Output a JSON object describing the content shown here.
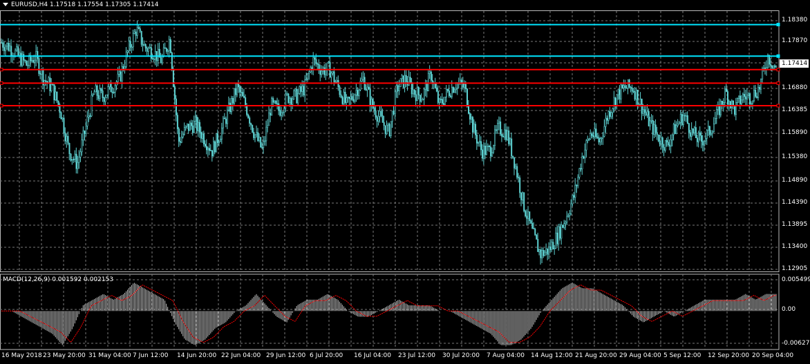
{
  "window": {
    "header": "EURUSD,H4  1.17518 1.17554 1.17305 1.17414",
    "current_price": "1.17414"
  },
  "macd_panel": {
    "header": "MACD(12,26,9) 0.001592 0.002153",
    "axis_labels": [
      "0.005499",
      "0.00",
      "-0.006272"
    ]
  },
  "price_axis": {
    "labels": [
      "1.18380",
      "1.17870",
      "1.17414",
      "1.16880",
      "1.16385",
      "1.15890",
      "1.15380",
      "1.14890",
      "1.14390",
      "1.13895",
      "1.13400",
      "1.12905"
    ]
  },
  "time_axis": {
    "labels": [
      "16 May 2018",
      "23 May 20:00",
      "31 May 04:00",
      "7 Jun 12:00",
      "14 Jun 20:00",
      "22 Jun 04:00",
      "29 Jun 12:00",
      "6 Jul 20:00",
      "16 Jul 04:00",
      "23 Jul 12:00",
      "30 Jul 20:00",
      "7 Aug 04:00",
      "14 Aug 12:00",
      "21 Aug 20:00",
      "29 Aug 04:00",
      "5 Sep 12:00",
      "12 Sep 20:00",
      "20 Sep 04:00"
    ]
  },
  "colors": {
    "background": "#000000",
    "grid": "#7a7a7a",
    "candles": "#5fd3d3",
    "resistance_lines": "#00e5ff",
    "support_lines": "#ff0000",
    "macd_histogram": "#c0c0c0",
    "macd_signal": "#ff0000"
  },
  "chart_data": {
    "type": "candlestick",
    "symbol": "EURUSD",
    "timeframe": "H4",
    "ohlc_last": {
      "open": 1.17518,
      "high": 1.17554,
      "low": 1.17305,
      "close": 1.17414
    },
    "ylim": [
      1.12905,
      1.187
    ],
    "x_range": [
      "16 May 2018",
      "20 Sep 04:00"
    ],
    "horizontal_levels": [
      {
        "price": 1.184,
        "color": "cyan"
      },
      {
        "price": 1.177,
        "color": "cyan"
      },
      {
        "price": 1.174,
        "color": "red"
      },
      {
        "price": 1.171,
        "color": "red"
      },
      {
        "price": 1.166,
        "color": "red"
      }
    ],
    "close_path": [
      [
        "16 May 2018",
        1.18
      ],
      [
        "17 May",
        1.179
      ],
      [
        "18 May",
        1.177
      ],
      [
        "21 May",
        1.175
      ],
      [
        "22 May",
        1.177
      ],
      [
        "23 May",
        1.172
      ],
      [
        "24 May",
        1.17
      ],
      [
        "25 May",
        1.165
      ],
      [
        "28 May",
        1.156
      ],
      [
        "29 May",
        1.153
      ],
      [
        "30 May",
        1.161
      ],
      [
        "31 May",
        1.169
      ],
      [
        "1 Jun",
        1.168
      ],
      [
        "4 Jun",
        1.17
      ],
      [
        "5 Jun",
        1.172
      ],
      [
        "6 Jun",
        1.178
      ],
      [
        "7 Jun",
        1.183
      ],
      [
        "8 Jun",
        1.179
      ],
      [
        "11 Jun",
        1.178
      ],
      [
        "12 Jun",
        1.176
      ],
      [
        "13 Jun",
        1.181
      ],
      [
        "14 Jun",
        1.158
      ],
      [
        "15 Jun",
        1.161
      ],
      [
        "18 Jun",
        1.162
      ],
      [
        "19 Jun",
        1.159
      ],
      [
        "20 Jun",
        1.156
      ],
      [
        "21 Jun",
        1.16
      ],
      [
        "22 Jun",
        1.165
      ],
      [
        "25 Jun",
        1.17
      ],
      [
        "26 Jun",
        1.166
      ],
      [
        "27 Jun",
        1.16
      ],
      [
        "28 Jun",
        1.156
      ],
      [
        "29 Jun",
        1.166
      ],
      [
        "2 Jul",
        1.165
      ],
      [
        "3 Jul",
        1.168
      ],
      [
        "4 Jul",
        1.168
      ],
      [
        "5 Jul",
        1.17
      ],
      [
        "6 Jul",
        1.176
      ],
      [
        "9 Jul",
        1.174
      ],
      [
        "10 Jul",
        1.174
      ],
      [
        "11 Jul",
        1.17
      ],
      [
        "12 Jul",
        1.166
      ],
      [
        "13 Jul",
        1.169
      ],
      [
        "16 Jul",
        1.172
      ],
      [
        "17 Jul",
        1.166
      ],
      [
        "18 Jul",
        1.163
      ],
      [
        "19 Jul",
        1.16
      ],
      [
        "20 Jul",
        1.17
      ],
      [
        "23 Jul",
        1.172
      ],
      [
        "24 Jul",
        1.169
      ],
      [
        "25 Jul",
        1.168
      ],
      [
        "26 Jul",
        1.173
      ],
      [
        "27 Jul",
        1.166
      ],
      [
        "30 Jul",
        1.169
      ],
      [
        "31 Jul",
        1.171
      ],
      [
        "1 Aug",
        1.17
      ],
      [
        "2 Aug",
        1.161
      ],
      [
        "3 Aug",
        1.156
      ],
      [
        "6 Aug",
        1.156
      ],
      [
        "7 Aug",
        1.161
      ],
      [
        "8 Aug",
        1.16
      ],
      [
        "9 Aug",
        1.153
      ],
      [
        "10 Aug",
        1.144
      ],
      [
        "13 Aug",
        1.138
      ],
      [
        "14 Aug",
        1.133
      ],
      [
        "15 Aug",
        1.134
      ],
      [
        "16 Aug",
        1.137
      ],
      [
        "17 Aug",
        1.141
      ],
      [
        "20 Aug",
        1.146
      ],
      [
        "21 Aug",
        1.155
      ],
      [
        "22 Aug",
        1.16
      ],
      [
        "23 Aug",
        1.158
      ],
      [
        "24 Aug",
        1.164
      ],
      [
        "27 Aug",
        1.168
      ],
      [
        "28 Aug",
        1.17
      ],
      [
        "29 Aug",
        1.17
      ],
      [
        "30 Aug",
        1.166
      ],
      [
        "31 Aug",
        1.162
      ],
      [
        "3 Sep",
        1.159
      ],
      [
        "4 Sep",
        1.157
      ],
      [
        "5 Sep",
        1.161
      ],
      [
        "6 Sep",
        1.164
      ],
      [
        "7 Sep",
        1.16
      ],
      [
        "10 Sep",
        1.158
      ],
      [
        "11 Sep",
        1.16
      ],
      [
        "12 Sep",
        1.164
      ],
      [
        "13 Sep",
        1.169
      ],
      [
        "14 Sep",
        1.165
      ],
      [
        "17 Sep",
        1.168
      ],
      [
        "18 Sep",
        1.168
      ],
      [
        "19 Sep",
        1.17
      ],
      [
        "20 Sep 04:00",
        1.177
      ],
      [
        "21 Sep",
        1.1741
      ]
    ],
    "macd": {
      "type": "histogram+line",
      "ylim": [
        -0.006272,
        0.005499
      ],
      "histogram": [
        0.0,
        0.0,
        -0.001,
        -0.002,
        -0.003,
        -0.004,
        -0.006,
        -0.003,
        0.001,
        0.002,
        0.003,
        0.002,
        0.003,
        0.005,
        0.004,
        0.003,
        0.002,
        -0.002,
        -0.005,
        -0.006,
        -0.005,
        -0.003,
        -0.002,
        0.0,
        0.001,
        0.003,
        0.001,
        -0.001,
        -0.002,
        0.001,
        0.002,
        0.002,
        0.003,
        0.002,
        0.0,
        -0.001,
        -0.001,
        0.0,
        0.001,
        0.002,
        0.001,
        0.001,
        0.001,
        0.0,
        0.0,
        -0.001,
        -0.002,
        -0.003,
        -0.004,
        -0.006,
        -0.006,
        -0.005,
        -0.003,
        0.0,
        0.002,
        0.004,
        0.005,
        0.004,
        0.004,
        0.003,
        0.002,
        0.001,
        -0.001,
        -0.002,
        -0.001,
        0.0,
        -0.001,
        0.0,
        0.001,
        0.002,
        0.002,
        0.002,
        0.002,
        0.003,
        0.002,
        0.003,
        0.003
      ]
    }
  }
}
